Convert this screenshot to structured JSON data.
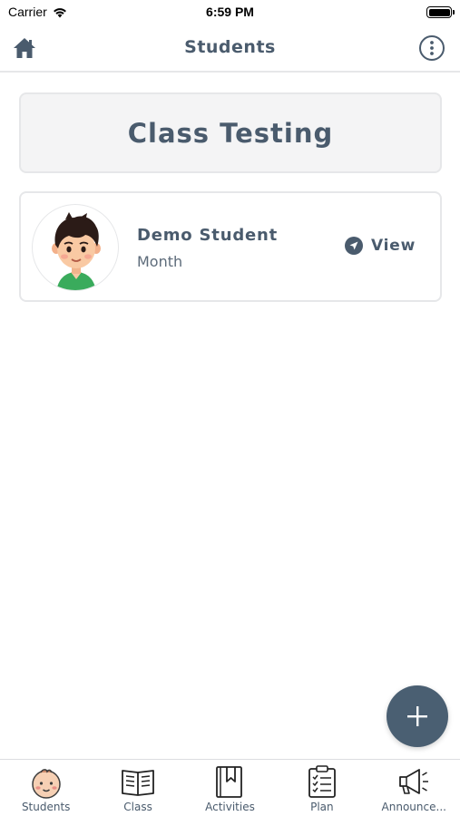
{
  "status_bar": {
    "carrier": "Carrier",
    "time": "6:59 PM"
  },
  "nav": {
    "title": "Students"
  },
  "class": {
    "title": "Class Testing"
  },
  "students": [
    {
      "name": "Demo Student",
      "subtitle": "Month",
      "action_label": "View"
    }
  ],
  "tabs": [
    {
      "label": "Students",
      "icon": "baby-face-icon",
      "active": true
    },
    {
      "label": "Class",
      "icon": "open-book-icon",
      "active": false
    },
    {
      "label": "Activities",
      "icon": "bookmark-book-icon",
      "active": false
    },
    {
      "label": "Plan",
      "icon": "clipboard-checklist-icon",
      "active": false
    },
    {
      "label": "Announce...",
      "icon": "megaphone-icon",
      "active": false
    }
  ],
  "colors": {
    "primary": "#4a5f72",
    "text": "#4a5b6d",
    "border": "#e6e7e9",
    "card_bg": "#f4f4f5"
  }
}
